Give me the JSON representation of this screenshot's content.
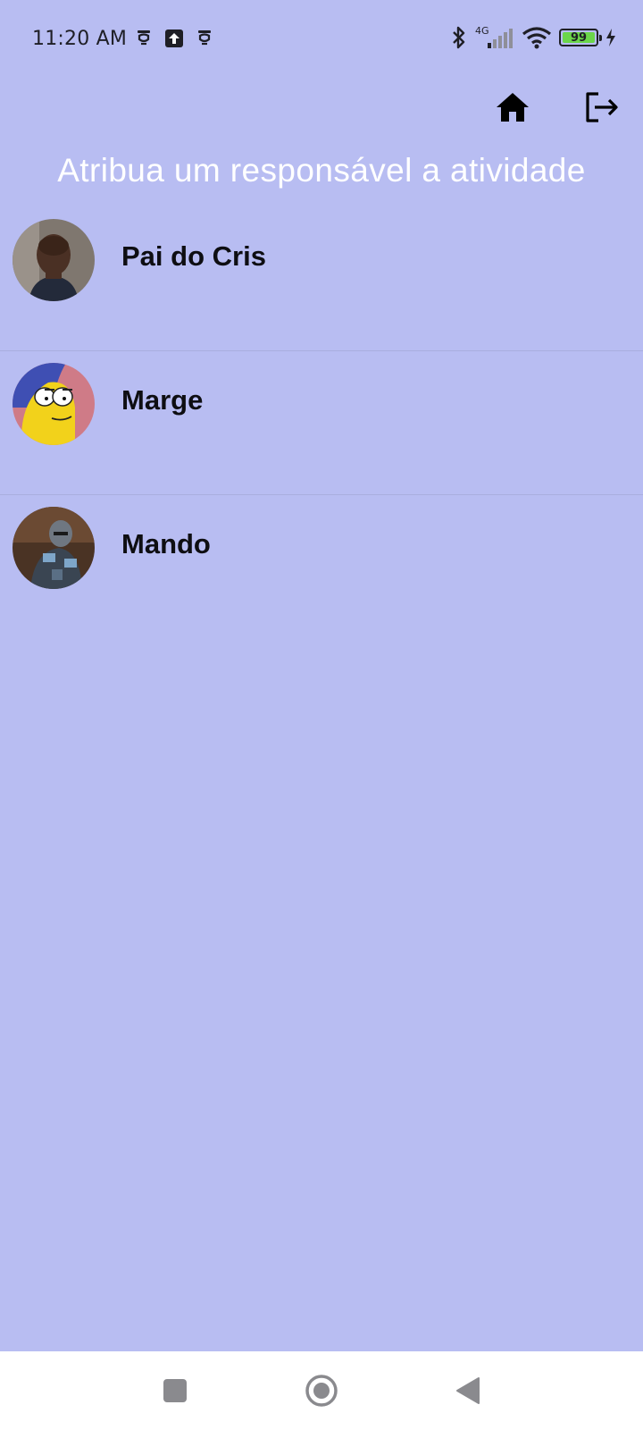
{
  "status_bar": {
    "time": "11:20 AM",
    "left_icons": [
      "sync-icon",
      "upload-icon",
      "sync-icon"
    ],
    "network_type": "4G",
    "battery_level": "99",
    "battery_color": "#6bd64a",
    "charging": true
  },
  "app_bar": {
    "home_icon": "home-icon",
    "logout_icon": "logout-icon"
  },
  "page": {
    "title": "Atribua um responsável a atividade",
    "background": "#b8bdf2"
  },
  "people": [
    {
      "name": "Pai do Cris",
      "avatar": "avatar-photo-man"
    },
    {
      "name": "Marge",
      "avatar": "avatar-cartoon-marge"
    },
    {
      "name": "Mando",
      "avatar": "avatar-armored-figure"
    }
  ],
  "nav_bar": {
    "recents_icon": "recents-square-icon",
    "home_icon": "home-circle-icon",
    "back_icon": "back-triangle-icon"
  }
}
